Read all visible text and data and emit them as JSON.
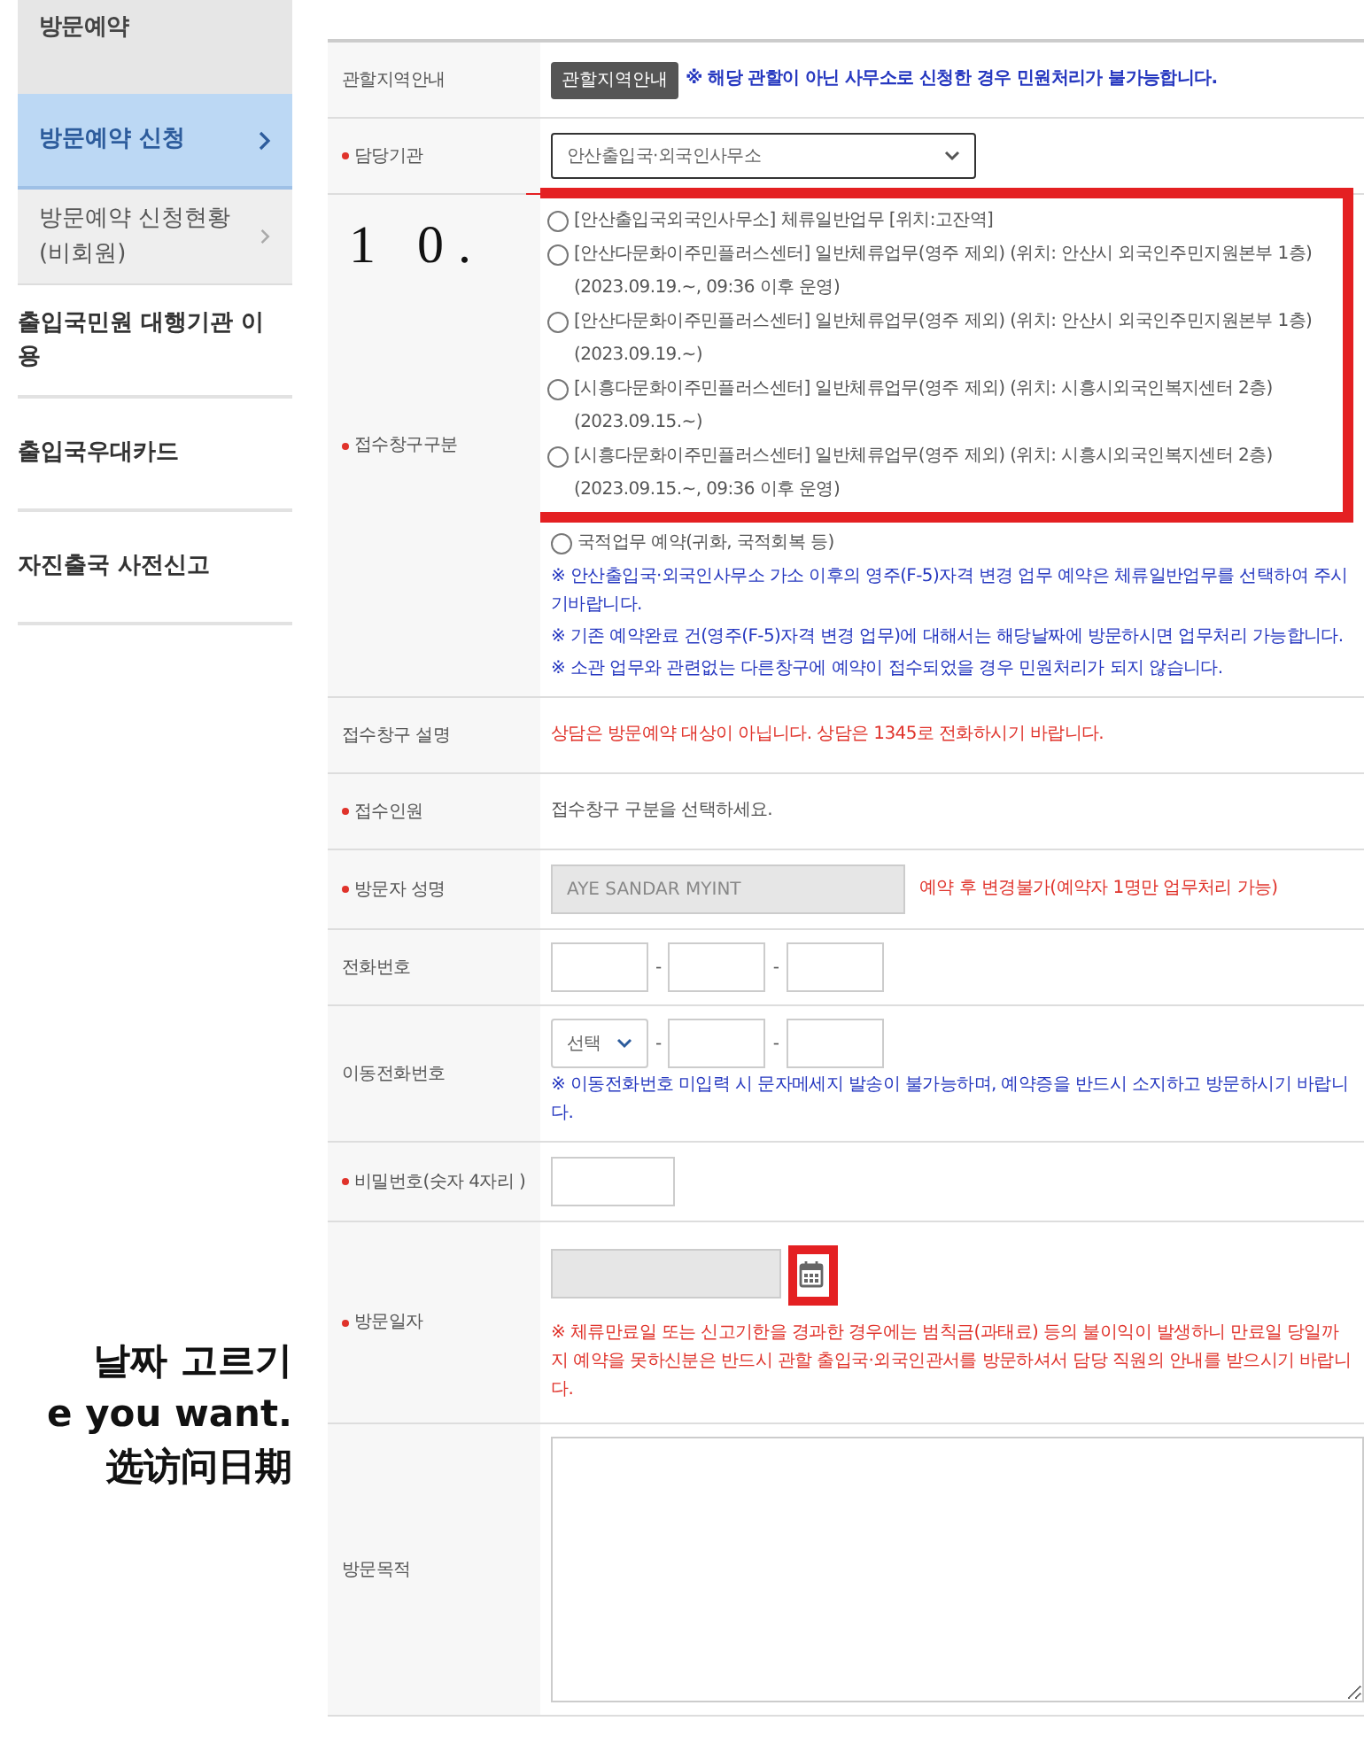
{
  "sidebar": {
    "title": "방문예약",
    "items": [
      {
        "label": "방문예약 신청",
        "kind": "sub",
        "selected": true,
        "arrow": true
      },
      {
        "label": "방문예약 신청현황(비회원)",
        "kind": "sub",
        "selected": false,
        "arrow": true
      },
      {
        "label": "출입국민원 대행기관 이용",
        "kind": "main",
        "selected": false,
        "arrow": false
      },
      {
        "label": "출입국우대카드",
        "kind": "main",
        "selected": false,
        "arrow": false
      },
      {
        "label": "자진출국 사전신고",
        "kind": "main",
        "selected": false,
        "arrow": false
      }
    ]
  },
  "caption_lines": [
    "날짜 고르기",
    "e you want.",
    "选访问日期"
  ],
  "form": {
    "rows": [
      {
        "label": "관할지역안내",
        "required": false,
        "kind": "button_note",
        "button": "관할지역안내",
        "notes": [
          {
            "text": "※ 해당 관할이 아닌 사무소로 신청한 경우 민원처리가 불가능합니다.",
            "color": "#2638c0"
          }
        ]
      },
      {
        "label": "담당기관",
        "required": true,
        "kind": "select",
        "value": "안산출입국·외국인사무소"
      },
      {
        "label": "접수창구구분",
        "required": true,
        "kind": "radios",
        "annotation": "1 0.",
        "options": [
          {
            "label": "[안산출입국외국인사무소] 체류일반업무 [위치:고잔역]",
            "selected": false,
            "highlighted": true
          },
          {
            "label": "[안산다문화이주민플러스센터] 일반체류업무(영주 제외) (위치: 안산시 외국인주민지원본부 1층)",
            "period": "(2023.09.19.~, 09:36 이후 운영)",
            "selected": false,
            "highlighted": true
          },
          {
            "label": "[안산다문화이주민플러스센터] 일반체류업무(영주 제외) (위치: 안산시 외국인주민지원본부 1층)",
            "period": "(2023.09.19.~)",
            "selected": false,
            "highlighted": true
          },
          {
            "label": "[시흥다문화이주민플러스센터] 일반체류업무(영주 제외) (위치: 시흥시외국인복지센터 2층)",
            "period": "(2023.09.15.~)",
            "selected": false,
            "highlighted": true
          },
          {
            "label": "[시흥다문화이주민플러스센터] 일반체류업무(영주 제외) (위치: 시흥시외국인복지센터 2층)",
            "period": "(2023.09.15.~, 09:36 이후 운영)",
            "selected": false,
            "highlighted": true
          },
          {
            "label": "국적업무 예약(귀화, 국적회복 등)",
            "selected": false,
            "highlighted": false
          }
        ],
        "notes": [
          {
            "text": "※ 안산출입국·외국인사무소 가소 이후의 영주(F-5)자격 변경 업무 예약은 체류일반업무를 선택하여 주시기바랍니다.",
            "color": "#2638c0"
          },
          {
            "text": "※ 기존 예약완료 건(영주(F-5)자격 변경 업무)에 대해서는 해당날짜에 방문하시면 업무처리 가능합니다.",
            "color": "#2638c0"
          },
          {
            "text": "※ 소관 업무와 관련없는 다른창구에 예약이 접수되었을 경우 민원처리가 되지 않습니다.",
            "color": "#2638c0"
          }
        ]
      },
      {
        "label": "접수창구 설명",
        "required": false,
        "kind": "text",
        "notes": [
          {
            "text": "상담은 방문예약 대상이 아닙니다. 상담은 1345로 전화하시기 바랍니다.",
            "color": "#e0332b"
          }
        ]
      },
      {
        "label": "접수인원",
        "required": true,
        "kind": "text",
        "notes": [
          {
            "text": "접수창구 구분을 선택하세요.",
            "color": "#555555"
          }
        ]
      },
      {
        "label": "방문자 성명",
        "required": true,
        "kind": "name",
        "value": "AYE SANDAR MYINT",
        "disabled": true,
        "notes": [
          {
            "text": "예약 후 변경불가(예약자 1명만 업무처리 가능)",
            "color": "#e0332b"
          }
        ]
      },
      {
        "label": "전화번호",
        "required": false,
        "kind": "phone",
        "separator": "-"
      },
      {
        "label": "이동전화번호",
        "required": false,
        "kind": "mobile",
        "select": "선택",
        "separator": "-",
        "notes": [
          {
            "text": "※ 이동전화번호 미입력 시 문자메세지 발송이 불가능하며, 예약증을 반드시 소지하고 방문하시기 바랍니다.",
            "color": "#2638c0"
          }
        ]
      },
      {
        "label": "비밀번호(숫자 4자리 )",
        "required": true,
        "kind": "password"
      },
      {
        "label": "방문일자",
        "required": true,
        "kind": "date",
        "disabled": true,
        "highlighted": true,
        "notes": [
          {
            "text": "※ 체류만료일 또는 신고기한을 경과한 경우에는 범칙금(과태료) 등의 불이익이 발생하니 만료일 당일까지 예약을 못하신분은 반드시 관할 출입국·외국인관서를 방문하셔서 담당 직원의 안내를 받으시기 바랍니다.",
            "color": "#e0332b"
          }
        ]
      },
      {
        "label": "방문목적",
        "required": false,
        "kind": "textarea"
      }
    ]
  }
}
